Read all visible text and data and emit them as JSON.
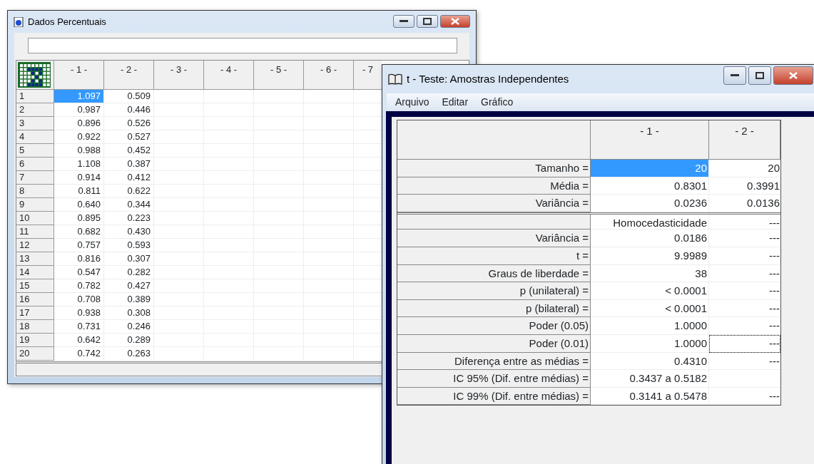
{
  "data_window": {
    "title": "Dados Percentuais",
    "columns": [
      "- 1 -",
      "- 2 -",
      "- 3 -",
      "- 4 -",
      "- 5 -",
      "- 6 -",
      "- 7"
    ],
    "rows": [
      {
        "row": "1",
        "cells": [
          {
            "text": "1.097",
            "selected": true
          },
          {
            "text": "0.509",
            "selected": false
          }
        ]
      },
      {
        "row": "2",
        "cells": [
          {
            "text": "0.987",
            "selected": false
          },
          {
            "text": "0.446",
            "selected": false
          }
        ]
      },
      {
        "row": "3",
        "cells": [
          {
            "text": "0.896",
            "selected": false
          },
          {
            "text": "0.526",
            "selected": false
          }
        ]
      },
      {
        "row": "4",
        "cells": [
          {
            "text": "0.922",
            "selected": false
          },
          {
            "text": "0.527",
            "selected": false
          }
        ]
      },
      {
        "row": "5",
        "cells": [
          {
            "text": "0.988",
            "selected": false
          },
          {
            "text": "0.452",
            "selected": false
          }
        ]
      },
      {
        "row": "6",
        "cells": [
          {
            "text": "1.108",
            "selected": false
          },
          {
            "text": "0.387",
            "selected": false
          }
        ]
      },
      {
        "row": "7",
        "cells": [
          {
            "text": "0.914",
            "selected": false
          },
          {
            "text": "0.412",
            "selected": false
          }
        ]
      },
      {
        "row": "8",
        "cells": [
          {
            "text": "0.811",
            "selected": false
          },
          {
            "text": "0.622",
            "selected": false
          }
        ]
      },
      {
        "row": "9",
        "cells": [
          {
            "text": "0.640",
            "selected": false
          },
          {
            "text": "0.344",
            "selected": false
          }
        ]
      },
      {
        "row": "10",
        "cells": [
          {
            "text": "0.895",
            "selected": false
          },
          {
            "text": "0.223",
            "selected": false
          }
        ]
      },
      {
        "row": "11",
        "cells": [
          {
            "text": "0.682",
            "selected": false
          },
          {
            "text": "0.430",
            "selected": false
          }
        ]
      },
      {
        "row": "12",
        "cells": [
          {
            "text": "0.757",
            "selected": false
          },
          {
            "text": "0.593",
            "selected": false
          }
        ]
      },
      {
        "row": "13",
        "cells": [
          {
            "text": "0.816",
            "selected": false
          },
          {
            "text": "0.307",
            "selected": false
          }
        ]
      },
      {
        "row": "14",
        "cells": [
          {
            "text": "0.547",
            "selected": false
          },
          {
            "text": "0.282",
            "selected": false
          }
        ]
      },
      {
        "row": "15",
        "cells": [
          {
            "text": "0.782",
            "selected": false
          },
          {
            "text": "0.427",
            "selected": false
          }
        ]
      },
      {
        "row": "16",
        "cells": [
          {
            "text": "0.708",
            "selected": false
          },
          {
            "text": "0.389",
            "selected": false
          }
        ]
      },
      {
        "row": "17",
        "cells": [
          {
            "text": "0.938",
            "selected": false
          },
          {
            "text": "0.308",
            "selected": false
          }
        ]
      },
      {
        "row": "18",
        "cells": [
          {
            "text": "0.731",
            "selected": false
          },
          {
            "text": "0.246",
            "selected": false
          }
        ]
      },
      {
        "row": "19",
        "cells": [
          {
            "text": "0.642",
            "selected": false
          },
          {
            "text": "0.289",
            "selected": false
          }
        ]
      },
      {
        "row": "20",
        "cells": [
          {
            "text": "0.742",
            "selected": false
          },
          {
            "text": "0.263",
            "selected": false
          }
        ]
      }
    ]
  },
  "test_window": {
    "title": "t - Teste: Amostras Independentes",
    "menu": [
      "Arquivo",
      "Editar",
      "Gráfico"
    ],
    "columns": [
      "- 1 -",
      "- 2 -"
    ],
    "rows": [
      {
        "label": "Tamanho =",
        "divider_before": false,
        "cells": [
          {
            "text": "20",
            "selected": true,
            "focused": false
          },
          {
            "text": "20",
            "selected": false,
            "focused": false
          }
        ]
      },
      {
        "label": "Média =",
        "divider_before": false,
        "cells": [
          {
            "text": "0.8301",
            "selected": false,
            "focused": false
          },
          {
            "text": "0.3991",
            "selected": false,
            "focused": false
          }
        ]
      },
      {
        "label": "Variância =",
        "divider_before": false,
        "cells": [
          {
            "text": "0.0236",
            "selected": false,
            "focused": false
          },
          {
            "text": "0.0136",
            "selected": false,
            "focused": false
          }
        ]
      },
      {
        "divider_before": true,
        "cells": [
          {
            "text": "Homocedasticidade",
            "selected": false,
            "focused": false
          },
          {
            "text": "---",
            "selected": false,
            "focused": false
          }
        ]
      },
      {
        "label": "Variância =",
        "divider_before": false,
        "cells": [
          {
            "text": "0.0186",
            "selected": false,
            "focused": false
          },
          {
            "text": "---",
            "selected": false,
            "focused": false
          }
        ]
      },
      {
        "label": "t =",
        "divider_before": false,
        "cells": [
          {
            "text": "9.9989",
            "selected": false,
            "focused": false
          },
          {
            "text": "---",
            "selected": false,
            "focused": false
          }
        ]
      },
      {
        "label": "Graus de liberdade =",
        "divider_before": false,
        "cells": [
          {
            "text": "38",
            "selected": false,
            "focused": false
          },
          {
            "text": "---",
            "selected": false,
            "focused": false
          }
        ]
      },
      {
        "label": "p (unilateral) =",
        "divider_before": false,
        "cells": [
          {
            "text": "< 0.0001",
            "selected": false,
            "focused": false
          },
          {
            "text": "---",
            "selected": false,
            "focused": false
          }
        ]
      },
      {
        "label": "p (bilateral) =",
        "divider_before": false,
        "cells": [
          {
            "text": "< 0.0001",
            "selected": false,
            "focused": false
          },
          {
            "text": "---",
            "selected": false,
            "focused": false
          }
        ]
      },
      {
        "label": "Poder (0.05)",
        "divider_before": false,
        "cells": [
          {
            "text": "1.0000",
            "selected": false,
            "focused": false
          },
          {
            "text": "---",
            "selected": false,
            "focused": false
          }
        ]
      },
      {
        "label": "Poder (0.01)",
        "divider_before": false,
        "cells": [
          {
            "text": "1.0000",
            "selected": false,
            "focused": false
          },
          {
            "text": "---",
            "selected": false,
            "focused": true
          }
        ]
      },
      {
        "label": "Diferença entre as médias =",
        "divider_before": false,
        "cells": [
          {
            "text": "0.4310",
            "selected": false,
            "focused": false
          },
          {
            "text": "---",
            "selected": false,
            "focused": false
          }
        ]
      },
      {
        "label": "IC 95% (Dif. entre médias) =",
        "divider_before": false,
        "cells": [
          {
            "text": "0.3437 a  0.5182",
            "selected": false,
            "focused": false
          },
          {
            "selected": false,
            "focused": false
          }
        ]
      },
      {
        "label": "IC 99% (Dif. entre médias) =",
        "divider_before": false,
        "cells": [
          {
            "text": "0.3141 a  0.5478",
            "selected": false,
            "focused": false
          },
          {
            "text": "---",
            "selected": false,
            "focused": false
          }
        ]
      }
    ]
  }
}
